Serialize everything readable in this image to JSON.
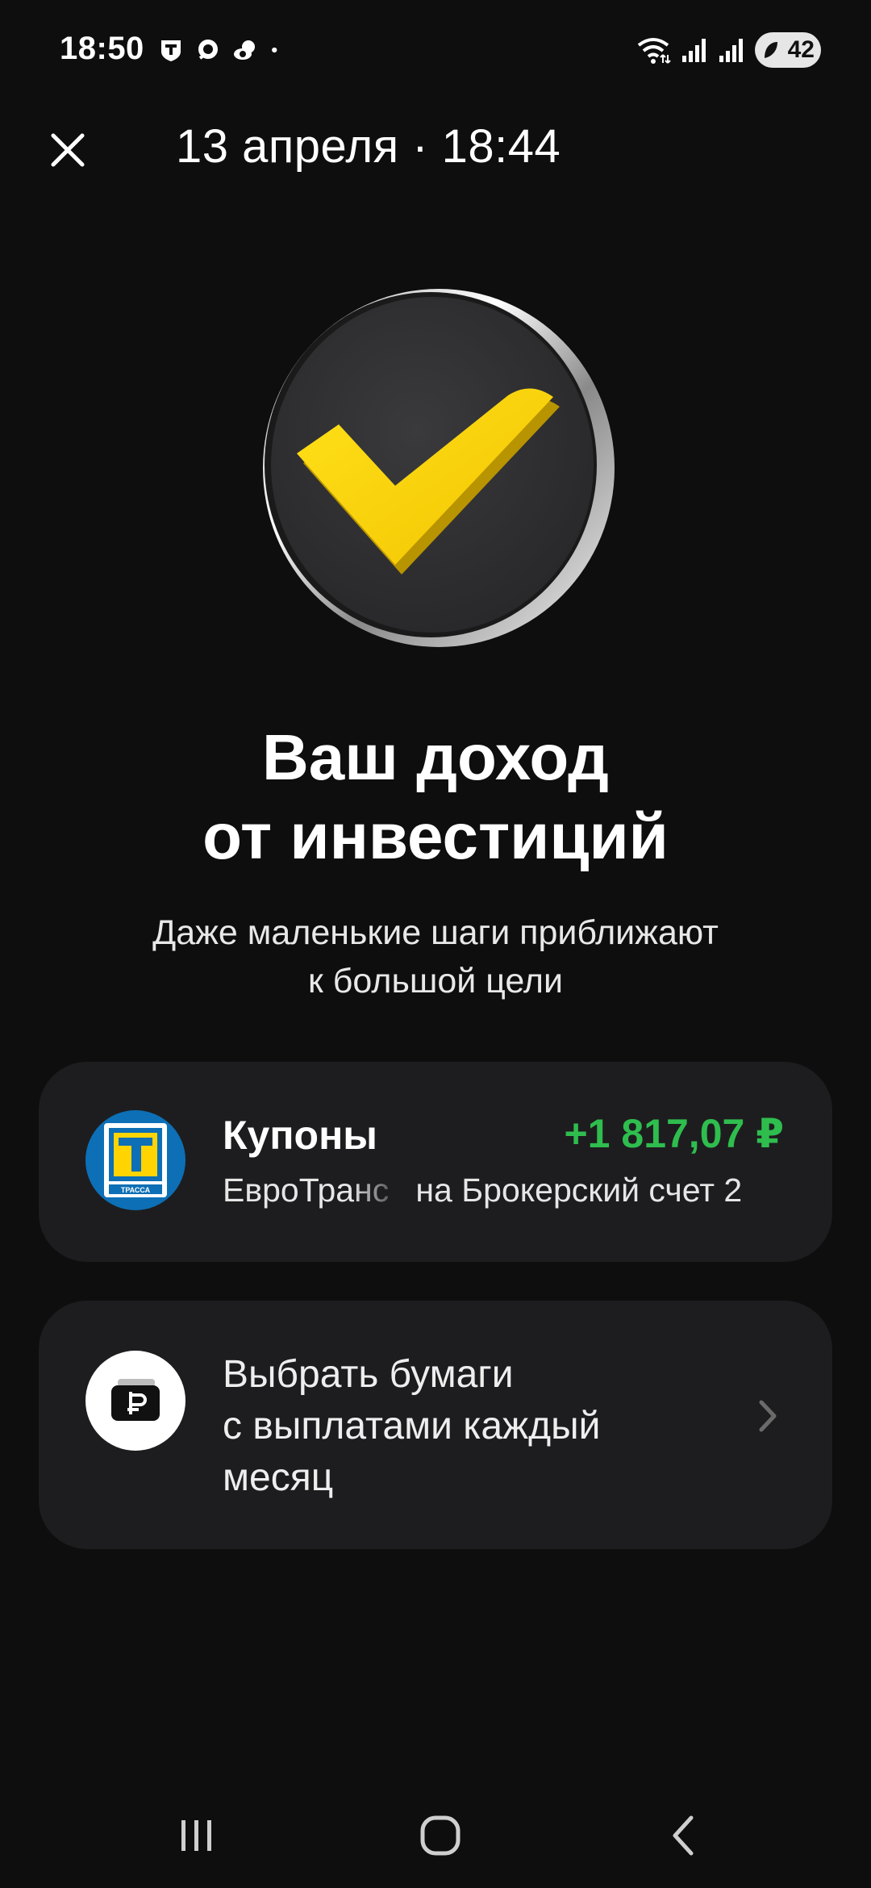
{
  "status_bar": {
    "time": "18:50",
    "battery": "42",
    "icons_left": [
      "tinkoff-icon",
      "chat-icon",
      "cloud-icon",
      "dot-icon"
    ],
    "icons_right": [
      "wifi-icon",
      "signal-icon",
      "signal-icon-2",
      "battery-icon"
    ]
  },
  "header": {
    "title": "13 апреля · 18:44"
  },
  "hero": {
    "headline_line1": "Ваш доход",
    "headline_line2": "от инвестиций",
    "subtext_line1": "Даже маленькие шаги приближают",
    "subtext_line2": "к большой цели",
    "coin_icon": "yellow-checkmark-coin"
  },
  "coupon_card": {
    "title": "Купоны",
    "amount": "+1 817,07 ₽",
    "issuer_short": "ЕвроТранс",
    "destination": "на Брокерский счет 2",
    "logo_label": "ТРАССА",
    "amount_color": "#2fbd4e"
  },
  "pick_card": {
    "line1": "Выбрать бумаги",
    "line2": "с выплатами каждый",
    "line3": "месяц",
    "icon": "ruble-wallet-icon"
  },
  "colors": {
    "background": "#0e0e0e",
    "card": "#1d1d1f",
    "accent_yellow": "#ffd400",
    "positive": "#2fbd4e"
  }
}
